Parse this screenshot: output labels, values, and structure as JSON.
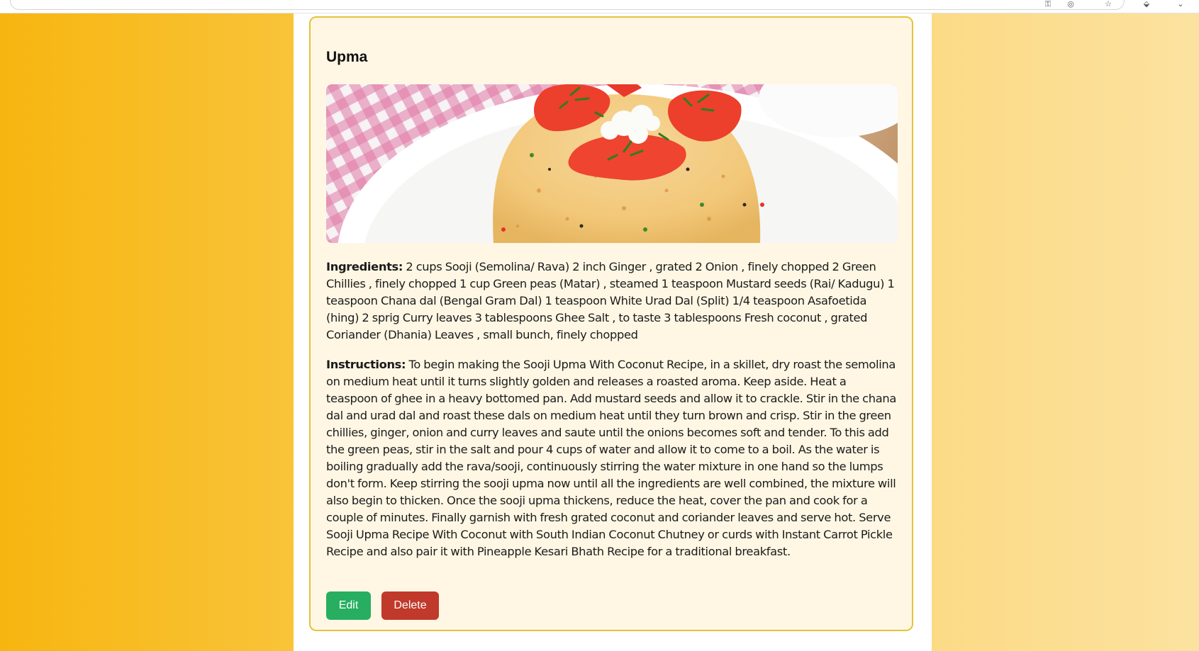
{
  "recipe": {
    "title": "Upma",
    "image_alt": "Upma",
    "ingredients_label": "Ingredients:",
    "ingredients_text": "2 cups Sooji (Semolina/ Rava) 2 inch Ginger , grated 2 Onion , finely chopped 2 Green Chillies , finely chopped 1 cup Green peas (Matar) , steamed 1 teaspoon Mustard seeds (Rai/ Kadugu) 1 teaspoon Chana dal (Bengal Gram Dal) 1 teaspoon White Urad Dal (Split) 1/4 teaspoon Asafoetida (hing) 2 sprig Curry leaves 3 tablespoons Ghee Salt , to taste 3 tablespoons Fresh coconut , grated Coriander (Dhania) Leaves , small bunch, finely chopped",
    "instructions_label": "Instructions:",
    "instructions_text": "To begin making the Sooji Upma With Coconut Recipe, in a skillet, dry roast the semolina on medium heat until it turns slightly golden and releases a roasted aroma. Keep aside. Heat a teaspoon of ghee in a heavy bottomed pan. Add mustard seeds and allow it to crackle. Stir in the chana dal and urad dal and roast these dals on medium heat until they turn brown and crisp. Stir in the green chillies, ginger, onion and curry leaves and saute until the onions becomes soft and tender. To this add the green peas, stir in the salt and pour 4 cups of water and allow it to come to a boil. As the water is boiling gradually add the rava/sooji, continuously stirring the water mixture in one hand so the lumps don't form. Keep stirring the sooji upma now until all the ingredients are well combined, the mixture will also begin to thicken. Once the sooji upma thickens, reduce the heat, cover the pan and cook for a couple of minutes. Finally garnish with fresh grated coconut and coriander leaves and serve hot. Serve Sooji Upma Recipe With Coconut with South Indian Coconut Chutney or curds with Instant Carrot Pickle Recipe and also pair it with Pineapple Kesari Bhath Recipe for a traditional breakfast."
  },
  "actions": {
    "edit_label": "Edit",
    "delete_label": "Delete"
  },
  "colors": {
    "page_gradient_start": "#f7b510",
    "page_gradient_end": "#fce2a0",
    "card_background": "#fff7e4",
    "card_border": "#e6c23a",
    "edit_button": "#27ae60",
    "delete_button": "#c0392b"
  },
  "browser": {
    "icons": [
      "key-icon",
      "profile-icon",
      "star-icon",
      "extension-icon",
      "menu-icon"
    ]
  }
}
